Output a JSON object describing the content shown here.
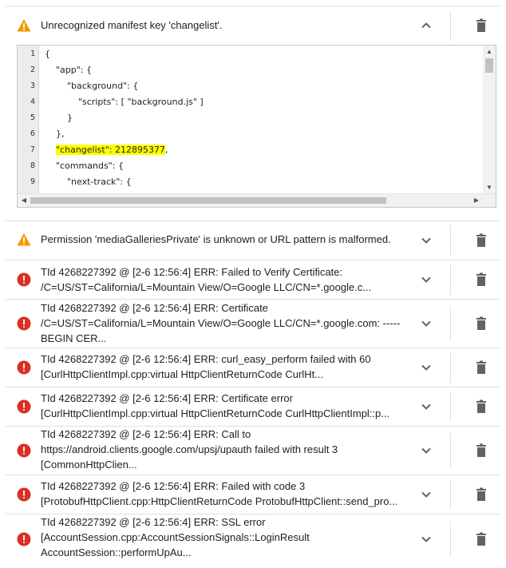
{
  "items": [
    {
      "type": "warning",
      "lines": [
        "Unrecognized manifest key 'changelist'."
      ],
      "expanded": true,
      "code": [
        {
          "n": "1",
          "text": "{"
        },
        {
          "n": "2",
          "text": "    \"app\": {"
        },
        {
          "n": "3",
          "text": "        \"background\": {"
        },
        {
          "n": "4",
          "text": "            \"scripts\": [ \"background.js\" ]"
        },
        {
          "n": "5",
          "text": "        }"
        },
        {
          "n": "6",
          "text": "    },"
        },
        {
          "n": "7",
          "prefix": "    ",
          "highlight": "\"changelist\": 212895377",
          "suffix": ","
        },
        {
          "n": "8",
          "text": "    \"commands\": {"
        },
        {
          "n": "9",
          "text": "        \"next-track\": {"
        }
      ]
    },
    {
      "type": "warning",
      "lines": [
        "Permission 'mediaGalleriesPrivate' is unknown or URL pattern is malformed."
      ]
    },
    {
      "type": "error",
      "lines": [
        "TId 4268227392 @ [2-6 12:56:4] ERR: Failed to Verify Certificate:",
        "/C=US/ST=California/L=Mountain View/O=Google LLC/CN=*.google.c..."
      ]
    },
    {
      "type": "error",
      "lines": [
        "TId 4268227392 @ [2-6 12:56:4] ERR: Certificate",
        "/C=US/ST=California/L=Mountain View/O=Google LLC/CN=*.google.com: -----",
        "BEGIN CER..."
      ]
    },
    {
      "type": "error",
      "lines": [
        "TId 4268227392 @ [2-6 12:56:4] ERR: curl_easy_perform failed with 60",
        "[CurlHttpClientImpl.cpp:virtual HttpClientReturnCode CurlHt..."
      ]
    },
    {
      "type": "error",
      "lines": [
        "TId 4268227392 @ [2-6 12:56:4] ERR: Certificate error",
        "[CurlHttpClientImpl.cpp:virtual HttpClientReturnCode CurlHttpClientImpl::p..."
      ]
    },
    {
      "type": "error",
      "lines": [
        "TId 4268227392 @ [2-6 12:56:4] ERR: Call to",
        "https://android.clients.google.com/upsj/upauth failed with result 3",
        "[CommonHttpClien..."
      ]
    },
    {
      "type": "error",
      "lines": [
        "TId 4268227392 @ [2-6 12:56:4] ERR: Failed with code 3",
        "[ProtobufHttpClient.cpp:HttpClientReturnCode ProtobufHttpClient::send_pro..."
      ]
    },
    {
      "type": "error",
      "lines": [
        "TId 4268227392 @ [2-6 12:56:4] ERR: SSL error",
        "[AccountSession.cpp:AccountSessionSignals::LoginResult",
        "AccountSession::performUpAu..."
      ]
    }
  ],
  "colors": {
    "warning": "#f29900",
    "error": "#d93025",
    "icon_gray": "#5f6368",
    "highlight": "#ffff00"
  }
}
